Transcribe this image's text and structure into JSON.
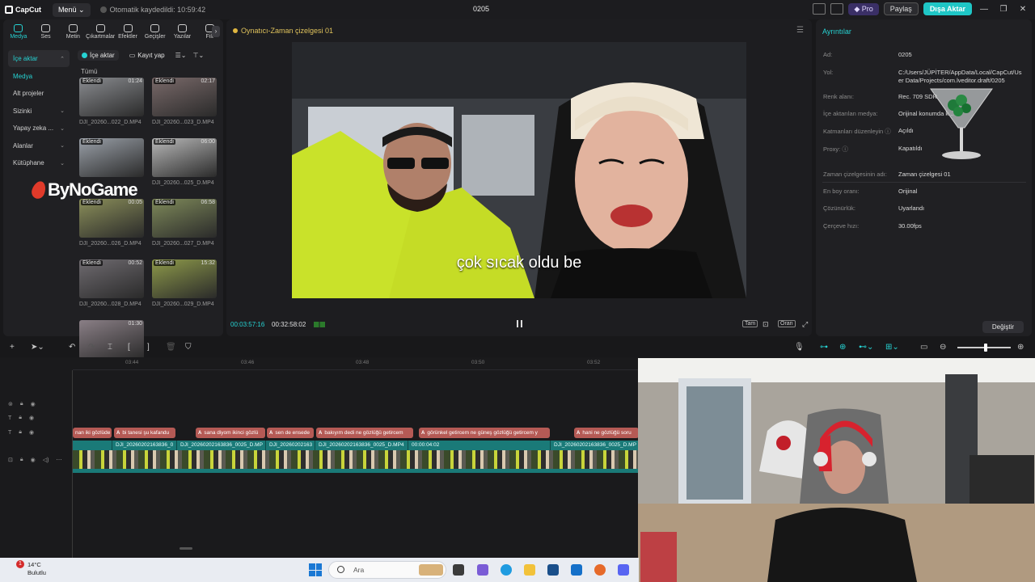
{
  "titlebar": {
    "app_name": "CapCut",
    "menu_label": "Menü",
    "autosave_text": "Otomatik kaydedildi: 10:59:42",
    "project_title": "0205",
    "pro_label": "Pro",
    "share_label": "Paylaş",
    "export_label": "Dışa Aktar"
  },
  "tools": [
    {
      "label": "Medya",
      "icon": "media-icon"
    },
    {
      "label": "Ses",
      "icon": "audio-icon"
    },
    {
      "label": "Metin",
      "icon": "text-icon"
    },
    {
      "label": "Çıkartmalar",
      "icon": "sticker-icon"
    },
    {
      "label": "Efektler",
      "icon": "effects-icon"
    },
    {
      "label": "Geçişler",
      "icon": "transition-icon"
    },
    {
      "label": "Yazılar",
      "icon": "captions-icon"
    },
    {
      "label": "Filt",
      "icon": "filter-icon"
    }
  ],
  "sidenav": [
    {
      "label": "İçe aktar",
      "chev": "⌃"
    },
    {
      "label": "Medya",
      "chev": ""
    },
    {
      "label": "Alt projeler",
      "chev": ""
    },
    {
      "label": "Sizinki",
      "chev": "⌄"
    },
    {
      "label": "Yapay zeka ...",
      "chev": "⌄"
    },
    {
      "label": "Alanlar",
      "chev": "⌄"
    },
    {
      "label": "Kütüphane",
      "chev": "⌄"
    }
  ],
  "media_toolbar": {
    "import_label": "İçe aktar",
    "record_label": "Kayıt yap"
  },
  "media_all_label": "Tümü",
  "media_clips": [
    {
      "badge": "Eklendi",
      "duration": "01:24",
      "name": "DJI_20260...022_D.MP4",
      "color": "#8a8c90"
    },
    {
      "badge": "Eklendi",
      "duration": "02:17",
      "name": "DJI_20260...023_D.MP4",
      "color": "#7a6a6a"
    },
    {
      "badge": "Eklendi",
      "duration": "",
      "name": "",
      "color": "#9aa0a8"
    },
    {
      "badge": "Eklendi",
      "duration": "06:00",
      "name": "DJI_20260...025_D.MP4",
      "color": "#b8b8b8"
    },
    {
      "badge": "Eklendi",
      "duration": "00:05",
      "name": "DJI_20260...026_D.MP4",
      "color": "#8b8f5a"
    },
    {
      "badge": "Eklendi",
      "duration": "06:58",
      "name": "DJI_20260...027_D.MP4",
      "color": "#7f8a5a"
    },
    {
      "badge": "Eklendi",
      "duration": "00:52",
      "name": "DJI_20260...028_D.MP4",
      "color": "#6f6b70"
    },
    {
      "badge": "Eklendi",
      "duration": "15:32",
      "name": "DJI_20260...029_D.MP4",
      "color": "#8e9a4a"
    },
    {
      "badge": "",
      "duration": "01:30",
      "name": "",
      "color": "#8a7f86"
    }
  ],
  "watermark": "ByNoGame",
  "player": {
    "title": "Oynatıcı-Zaman çizelgesi 01",
    "subtitle": "çok sıcak oldu be",
    "current_time": "00:03:57:16",
    "total_time": "00:32:58:02",
    "full_label": "Tam",
    "ratio_label": "Oran"
  },
  "details": {
    "heading": "Ayrıntılar",
    "rows": [
      {
        "k": "Ad:",
        "v": "0205"
      },
      {
        "k": "Yol:",
        "v": "C:/Users/JÜPİTER/AppData/Local/CapCut/User Data/Projects/com.lveditor.draft/0205"
      },
      {
        "k": "Renk alanı:",
        "v": "Rec. 709 SDR"
      },
      {
        "k": "İçe aktarılan medya:",
        "v": "Orijinal konumda k..."
      },
      {
        "k": "Katmanları düzenleyin ⓘ",
        "v": "Açıldı"
      },
      {
        "k": "Proxy: ⓘ",
        "v": "Kapatıldı"
      },
      {
        "k": "Zaman çizelgesinin adı:",
        "v": "Zaman çizelgesi 01"
      },
      {
        "k": "En boy oranı:",
        "v": "Orijinal"
      },
      {
        "k": "Çözünürlük:",
        "v": "Uyarlandı"
      },
      {
        "k": "Çerçeve hızı:",
        "v": "30.00fps"
      }
    ],
    "change_label": "Değiştir"
  },
  "timeline": {
    "ruler_ticks": [
      "03:44",
      "03:46",
      "03:48",
      "03:50",
      "03:52"
    ],
    "text_clips": [
      "nan iki gözlüde",
      "bi tanesi şu kafandu",
      "sana diyom ikinci gözlü",
      "sen de ensede",
      "bakıyım dedi ne gözlüğü getircem",
      "görünkel getircem ne güneş gözlüğü getircem y",
      "hani ne gözlüğü soru"
    ],
    "video_labels": [
      "DJI_20260202163836_0",
      "DJI_20260202163836_0025_D.MP",
      "DJI_20260202163",
      "DJI_20260202163836_0025_D.MP4",
      "00:00:04:02",
      "DJI_20260202163836_0025_D.MP"
    ]
  },
  "taskbar": {
    "temp": "14°C",
    "weather": "Bulutlu",
    "alert_count": "1",
    "search_placeholder": "Ara"
  },
  "colors": {
    "accent": "#26d3d3",
    "text_clip": "#b55a55",
    "video_track": "#1a7a78"
  }
}
